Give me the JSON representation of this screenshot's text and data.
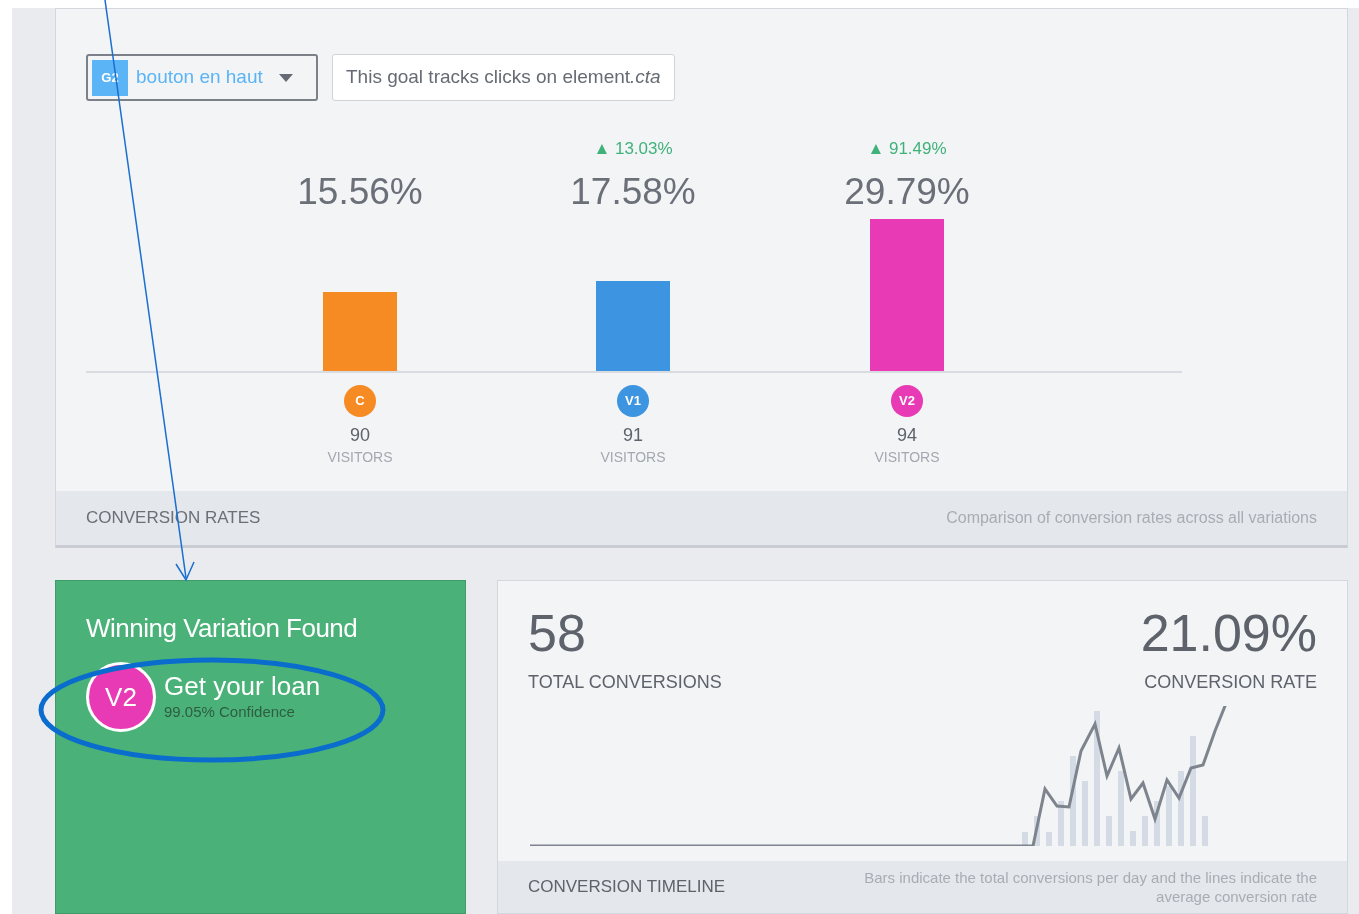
{
  "goal": {
    "badge": "G2",
    "name": "bouton en haut",
    "description": "This goal tracks clicks on element ",
    "selector": ".cta"
  },
  "conversion_rates": {
    "chart_data": {
      "type": "bar",
      "categories": [
        "C",
        "V1",
        "V2"
      ],
      "values": [
        15.56,
        17.58,
        29.79
      ],
      "value_labels": [
        "15.56%",
        "17.58%",
        "29.79%"
      ]
    },
    "variations": [
      {
        "color": "#f68b24",
        "visitors": "90",
        "visitors_label": "VISITORS"
      },
      {
        "color": "#3d94e0",
        "lift": "▲ 13.03%",
        "visitors": "91",
        "visitors_label": "VISITORS"
      },
      {
        "color": "#e83ab4",
        "lift": "▲ 91.49%",
        "visitors": "94",
        "visitors_label": "VISITORS"
      }
    ],
    "footer_title": "CONVERSION RATES",
    "footer_note": "Comparison of conversion rates across all variations"
  },
  "winner": {
    "title": "Winning Variation Found",
    "badge": "V2",
    "name": "Get your loan",
    "confidence": "99.05% Confidence"
  },
  "timeline": {
    "total": "58",
    "total_label": "TOTAL CONVERSIONS",
    "rate": "21.09%",
    "rate_label": "CONVERSION RATE",
    "footer_title": "CONVERSION TIMELINE",
    "footer_note": "Bars indicate the total conversions per day and the lines indicate the average conversion rate"
  }
}
